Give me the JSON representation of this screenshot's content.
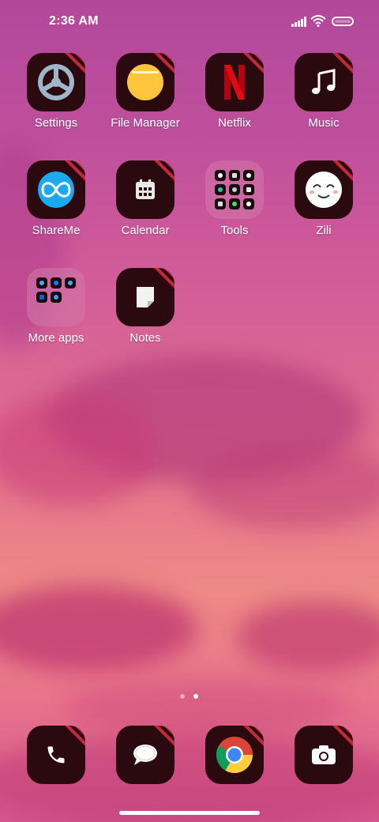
{
  "status": {
    "time": "2:36 AM",
    "signal_icon": "signal-bars-icon",
    "wifi_icon": "wifi-icon",
    "battery_icon": "battery-icon"
  },
  "apps": [
    {
      "label": "Settings",
      "icon": "settings-icon"
    },
    {
      "label": "File Manager",
      "icon": "file-manager-icon"
    },
    {
      "label": "Netflix",
      "icon": "netflix-icon"
    },
    {
      "label": "Music",
      "icon": "music-note-icon"
    },
    {
      "label": "ShareMe",
      "icon": "shareme-icon"
    },
    {
      "label": "Calendar",
      "icon": "calendar-icon"
    },
    {
      "label": "Tools",
      "icon": "folder-icon"
    },
    {
      "label": "Zili",
      "icon": "zili-icon"
    },
    {
      "label": "More apps",
      "icon": "folder-icon"
    },
    {
      "label": "Notes",
      "icon": "notes-icon"
    }
  ],
  "page_indicator": {
    "pages": 2,
    "current": 2
  },
  "dock": [
    {
      "icon": "phone-icon"
    },
    {
      "icon": "messages-icon"
    },
    {
      "icon": "chrome-icon"
    },
    {
      "icon": "camera-icon"
    }
  ],
  "colors": {
    "icon_bg": "#2a0a0f",
    "stripe": "#c0283c",
    "netflix_red": "#e50914",
    "file_yellow": "#ffc53d",
    "shareme_blue": "#1aa8f0"
  }
}
